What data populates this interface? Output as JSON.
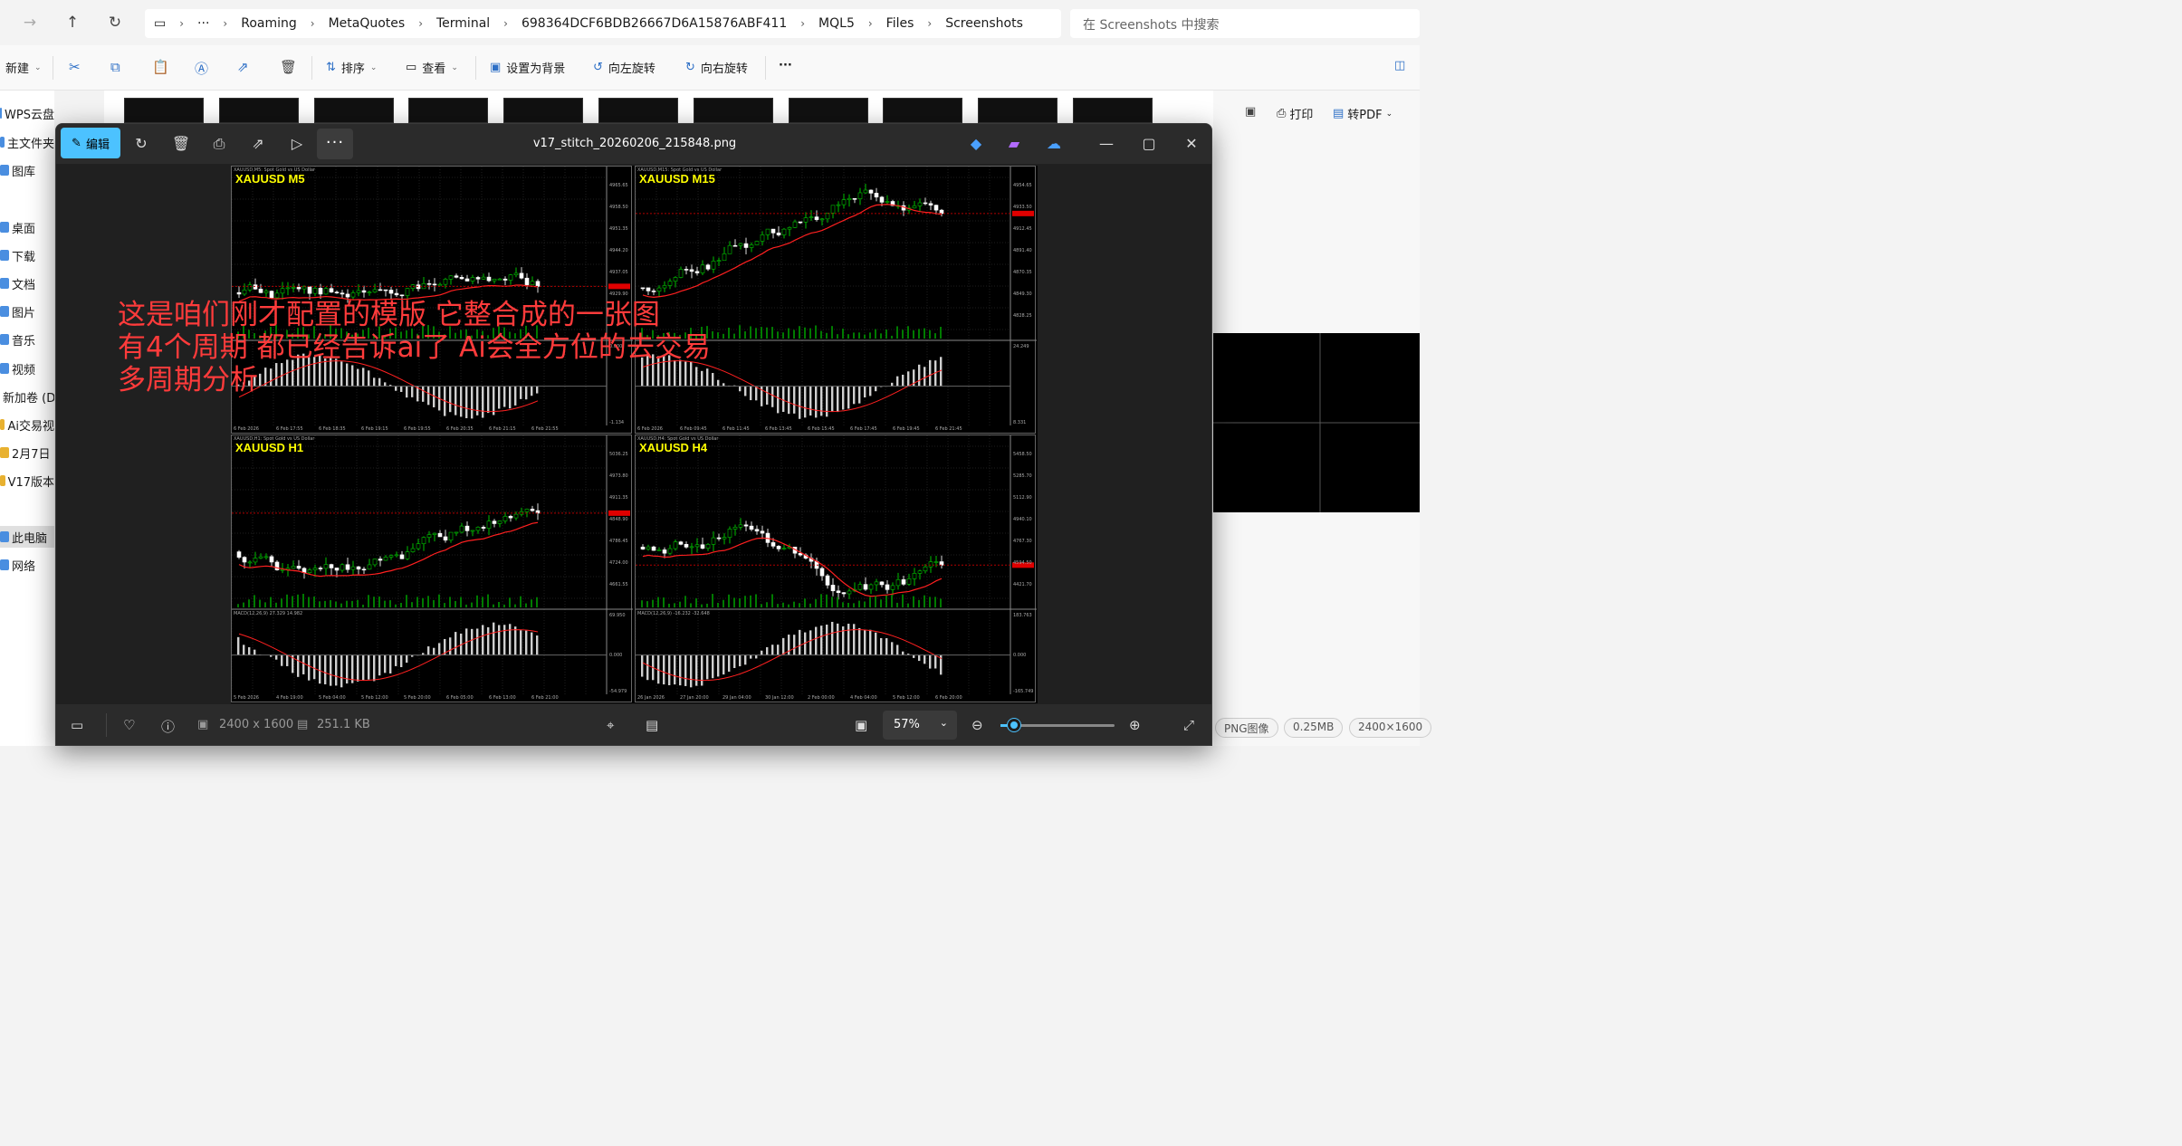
{
  "explorer": {
    "breadcrumbs": [
      "Roaming",
      "MetaQuotes",
      "Terminal",
      "698364DCF6BDB26667D6A15876ABF411",
      "MQL5",
      "Files",
      "Screenshots"
    ],
    "more": "···",
    "search_placeholder": "在 Screenshots 中搜索",
    "toolbar": {
      "new": "新建",
      "sort": "排序",
      "view": "查看",
      "set_background": "设置为背景",
      "rotate_left": "向左旋转",
      "rotate_right": "向右旋转",
      "more": "···"
    },
    "sidebar": [
      {
        "label": "WPS云盘",
        "type": "cloud"
      },
      {
        "label": "主文件夹",
        "type": "home"
      },
      {
        "label": "图库",
        "type": "gallery"
      },
      {
        "label": "桌面",
        "type": "desktop"
      },
      {
        "label": "下载",
        "type": "download"
      },
      {
        "label": "文档",
        "type": "docs"
      },
      {
        "label": "图片",
        "type": "pictures"
      },
      {
        "label": "音乐",
        "type": "music"
      },
      {
        "label": "视频",
        "type": "video"
      },
      {
        "label": "新加卷 (D",
        "type": "drive"
      },
      {
        "label": "Ai交易视",
        "type": "folder"
      },
      {
        "label": "2月7日",
        "type": "folder"
      },
      {
        "label": "V17版本",
        "type": "folder"
      },
      {
        "label": "此电脑",
        "type": "pc",
        "selected": true
      },
      {
        "label": "网络",
        "type": "network"
      }
    ],
    "right_pane": {
      "print": "打印",
      "to_pdf": "转PDF",
      "chips": [
        "PNG图像",
        "0.25MB",
        "2400×1600"
      ]
    }
  },
  "viewer": {
    "edit_label": "编辑",
    "filename": "v17_stitch_20260206_215848.png",
    "more": "···",
    "dimensions": "2400 x 1600",
    "filesize": "251.1 KB",
    "zoom": "57%",
    "zoom_fraction": 0.12
  },
  "image": {
    "overlay_lines": [
      "这是咱们刚才配置的模版  它整合成的一张图",
      "有4个周期 都已经告诉ai了 Ai会全方位的去交易",
      "多周期分析"
    ],
    "panels": [
      {
        "title": "XAUUSD M5",
        "info": "XAUUSD,M5: Spot Gold vs US Dollar",
        "prices": [
          "4965.65",
          "4958.50",
          "4951.35",
          "4944.20",
          "4937.05",
          "4929.90"
        ],
        "macd_scale": [
          "0.000",
          "-1.134"
        ],
        "dates": [
          "6 Feb 2026",
          "6 Feb 17:55",
          "6 Feb 18:35",
          "6 Feb 19:15",
          "6 Feb 19:55",
          "6 Feb 20:35",
          "6 Feb 21:15",
          "6 Feb 21:55"
        ]
      },
      {
        "title": "XAUUSD M15",
        "info": "XAUUSD,M15: Spot Gold vs US Dollar",
        "prices": [
          "4954.65",
          "4933.50",
          "4912.45",
          "4891.40",
          "4870.35",
          "4849.30",
          "4828.25"
        ],
        "macd_scale": [
          "24.249",
          "8.331"
        ],
        "dates": [
          "6 Feb 2026",
          "6 Feb 09:45",
          "6 Feb 11:45",
          "6 Feb 13:45",
          "6 Feb 15:45",
          "6 Feb 17:45",
          "6 Feb 19:45",
          "6 Feb 21:45"
        ]
      },
      {
        "title": "XAUUSD H1",
        "info": "XAUUSD,H1: Spot Gold vs US Dollar",
        "prices": [
          "5036.25",
          "4973.80",
          "4911.35",
          "4848.90",
          "4786.45",
          "4724.00",
          "4661.55"
        ],
        "macd_info": "MACD(12,26,9) 27.329 14.982",
        "macd_scale": [
          "69.950",
          "0.000",
          "-54.979"
        ],
        "dates": [
          "5 Feb 2026",
          "4 Feb 19:00",
          "5 Feb 04:00",
          "5 Feb 12:00",
          "5 Feb 20:00",
          "6 Feb 05:00",
          "6 Feb 13:00",
          "6 Feb 21:00"
        ]
      },
      {
        "title": "XAUUSD H4",
        "info": "XAUUSD,H4: Spot Gold vs US Dollar",
        "prices": [
          "5458.50",
          "5285.70",
          "5112.90",
          "4940.10",
          "4767.30",
          "4594.50",
          "4421.70"
        ],
        "macd_info": "MACD(12,26,9) -16.232 -32.648",
        "macd_scale": [
          "183.763",
          "0.000",
          "-165.749"
        ],
        "dates": [
          "26 Jan 2026",
          "27 Jan 20:00",
          "29 Jan 04:00",
          "30 Jan 12:00",
          "2 Feb 00:00",
          "4 Feb 04:00",
          "5 Feb 12:00",
          "6 Feb 20:00"
        ]
      }
    ]
  },
  "colors": {
    "accent": "#4cc2ff",
    "overlay_text": "#ff3b3b",
    "ma_line": "#ff0000",
    "bull": "#00c000",
    "bear": "#ffffff",
    "title": "#ffff00"
  }
}
